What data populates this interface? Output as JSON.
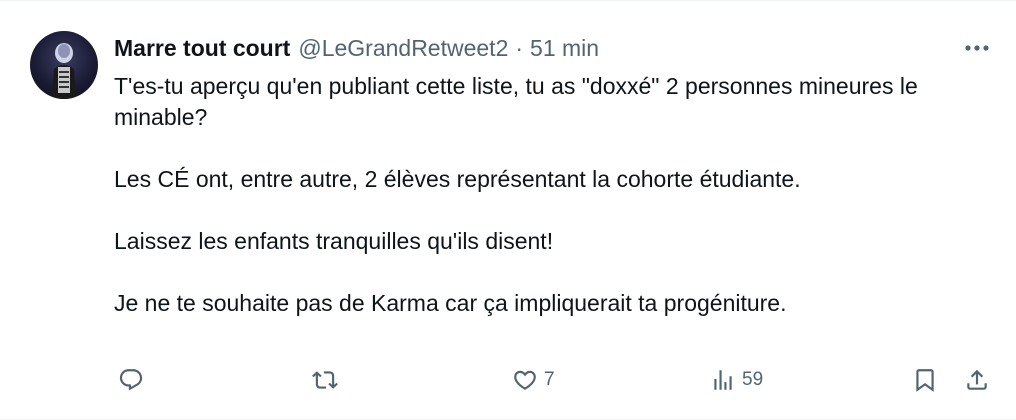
{
  "tweet": {
    "display_name": "Marre tout court",
    "handle": "@LeGrandRetweet2",
    "separator": "·",
    "timestamp": "51 min",
    "paragraphs": [
      "T'es-tu aperçu qu'en publiant cette liste, tu as \"doxxé\" 2 personnes mineures le minable?",
      "Les CÉ ont, entre autre, 2 élèves représentant la cohorte étudiante.",
      "Laissez les enfants tranquilles qu'ils disent!",
      "Je ne te souhaite pas de Karma car ça impliquerait ta progéniture."
    ]
  },
  "actions": {
    "reply": {
      "icon": "reply-icon",
      "count": ""
    },
    "retweet": {
      "icon": "retweet-icon",
      "count": ""
    },
    "like": {
      "icon": "heart-icon",
      "count": "7"
    },
    "views": {
      "icon": "views-icon",
      "count": "59"
    },
    "bookmark": {
      "icon": "bookmark-icon"
    },
    "share": {
      "icon": "share-icon"
    }
  },
  "colors": {
    "text_primary": "#0f1419",
    "text_secondary": "#536471",
    "divider": "#eff3f4"
  }
}
